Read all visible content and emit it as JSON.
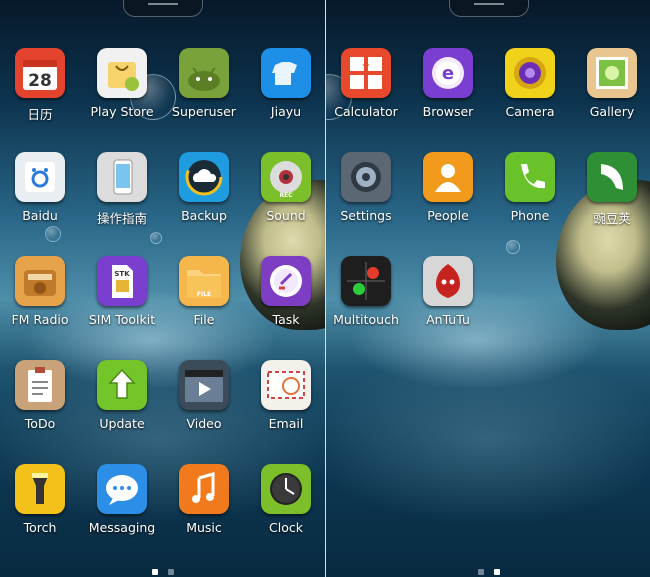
{
  "screens": [
    {
      "apps": [
        {
          "label": "日历",
          "icon": "calendar-icon",
          "color": "#e4432e",
          "text": "28"
        },
        {
          "label": "Play Store",
          "icon": "play-store-icon",
          "color": "#f1f1f1"
        },
        {
          "label": "Superuser",
          "icon": "superuser-icon",
          "color": "#7aa23a"
        },
        {
          "label": "Jiayu",
          "icon": "jiayu-icon",
          "color": "#1e8fe6"
        },
        {
          "label": "Baidu",
          "icon": "baidu-icon",
          "color": "#e9eef2"
        },
        {
          "label": "操作指南",
          "icon": "guide-phone-icon",
          "color": "#dcdcdc"
        },
        {
          "label": "Backup",
          "icon": "backup-cloud-icon",
          "color": "#1f9be0"
        },
        {
          "label": "Sound",
          "icon": "sound-icon",
          "color": "#7bbf2a",
          "text": "REC"
        },
        {
          "label": "FM Radio",
          "icon": "radio-icon",
          "color": "#e6a34a"
        },
        {
          "label": "SIM Toolkit",
          "icon": "sim-card-icon",
          "color": "#7b3fd0",
          "text": "STK"
        },
        {
          "label": "File",
          "icon": "folder-icon",
          "color": "#f5b74c",
          "text": "FILE"
        },
        {
          "label": "Task",
          "icon": "task-icon",
          "color": "#7d3ec4"
        },
        {
          "label": "ToDo",
          "icon": "clipboard-icon",
          "color": "#c9a27a"
        },
        {
          "label": "Update",
          "icon": "update-arrow-icon",
          "color": "#74c52a"
        },
        {
          "label": "Video",
          "icon": "video-clapper-icon",
          "color": "#3b4b5a"
        },
        {
          "label": "Email",
          "icon": "email-envelope-icon",
          "color": "#f4f0ea"
        },
        {
          "label": "Torch",
          "icon": "torch-icon",
          "color": "#f2c11a"
        },
        {
          "label": "Messaging",
          "icon": "message-bubble-icon",
          "color": "#2d8ee8"
        },
        {
          "label": "Music",
          "icon": "music-note-icon",
          "color": "#f07a1c"
        },
        {
          "label": "Clock",
          "icon": "clock-icon",
          "color": "#7cbf2b"
        }
      ],
      "active_page": 0
    },
    {
      "apps": [
        {
          "label": "Calculator",
          "icon": "calculator-icon",
          "color": "#e8492c"
        },
        {
          "label": "Browser",
          "icon": "browser-icon",
          "color": "#7a3ed0",
          "text": "e"
        },
        {
          "label": "Camera",
          "icon": "camera-icon",
          "color": "#f1d21a"
        },
        {
          "label": "Gallery",
          "icon": "gallery-icon",
          "color": "#e9c590"
        },
        {
          "label": "Settings",
          "icon": "settings-gear-icon",
          "color": "#5c6774"
        },
        {
          "label": "People",
          "icon": "people-icon",
          "color": "#f19a1c"
        },
        {
          "label": "Phone",
          "icon": "phone-handset-icon",
          "color": "#6ac22a"
        },
        {
          "label": "豌豆荚",
          "icon": "wandoujia-icon",
          "color": "#2f8f34"
        },
        {
          "label": "Multitouch",
          "icon": "multitouch-icon",
          "color": "#1e1e1e"
        },
        {
          "label": "AnTuTu",
          "icon": "antutu-icon",
          "color": "#d7d7d7"
        }
      ],
      "active_page": 1
    }
  ],
  "page_count": 2
}
